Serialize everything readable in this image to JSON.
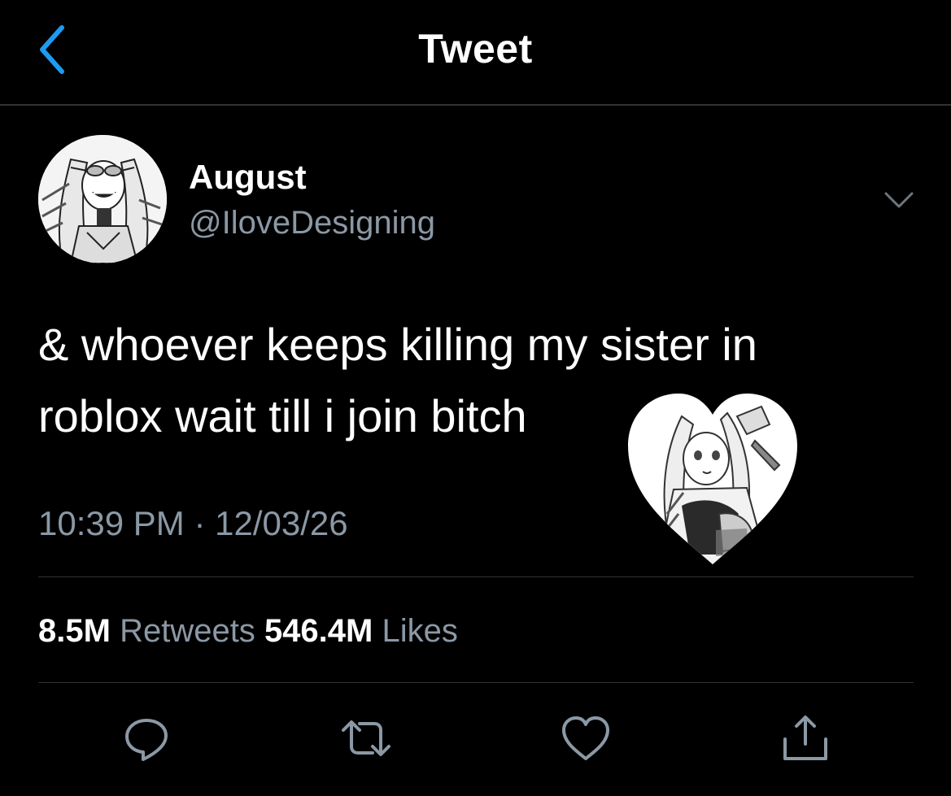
{
  "header": {
    "title": "Tweet",
    "back_icon": "chevron-left-icon"
  },
  "author": {
    "display_name": "August",
    "handle": "@IloveDesigning"
  },
  "tweet": {
    "text": "& whoever keeps killing my sister in roblox wait till i join bitch",
    "time": "10:39 PM · 12/03/26"
  },
  "stats": {
    "retweets_count": "8.5M",
    "retweets_label": "Retweets",
    "likes_count": "546.4M",
    "likes_label": "Likes"
  },
  "actions": {
    "reply_icon": "reply-icon",
    "retweet_icon": "retweet-icon",
    "like_icon": "heart-icon",
    "share_icon": "share-icon"
  },
  "colors": {
    "background": "#000000",
    "accent": "#1d9bf0",
    "secondary_text": "#8b98a5",
    "divider": "#2f3336"
  }
}
